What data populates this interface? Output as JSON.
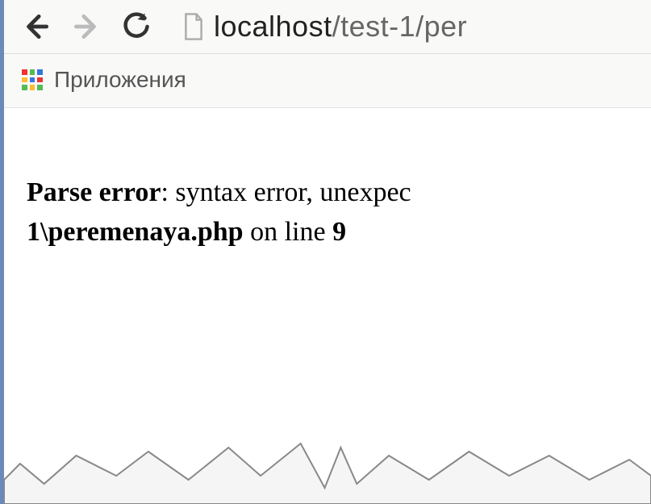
{
  "address": {
    "host": "localhost",
    "path": "/test-1/per"
  },
  "bookmarks": {
    "apps_label": "Приложения"
  },
  "error": {
    "prefix_bold": "Parse error",
    "msg_after_prefix": ": syntax error, unexpec",
    "path_bold": "1\\peremenaya.php",
    "tail_plain": " on line ",
    "line_bold": "9"
  }
}
